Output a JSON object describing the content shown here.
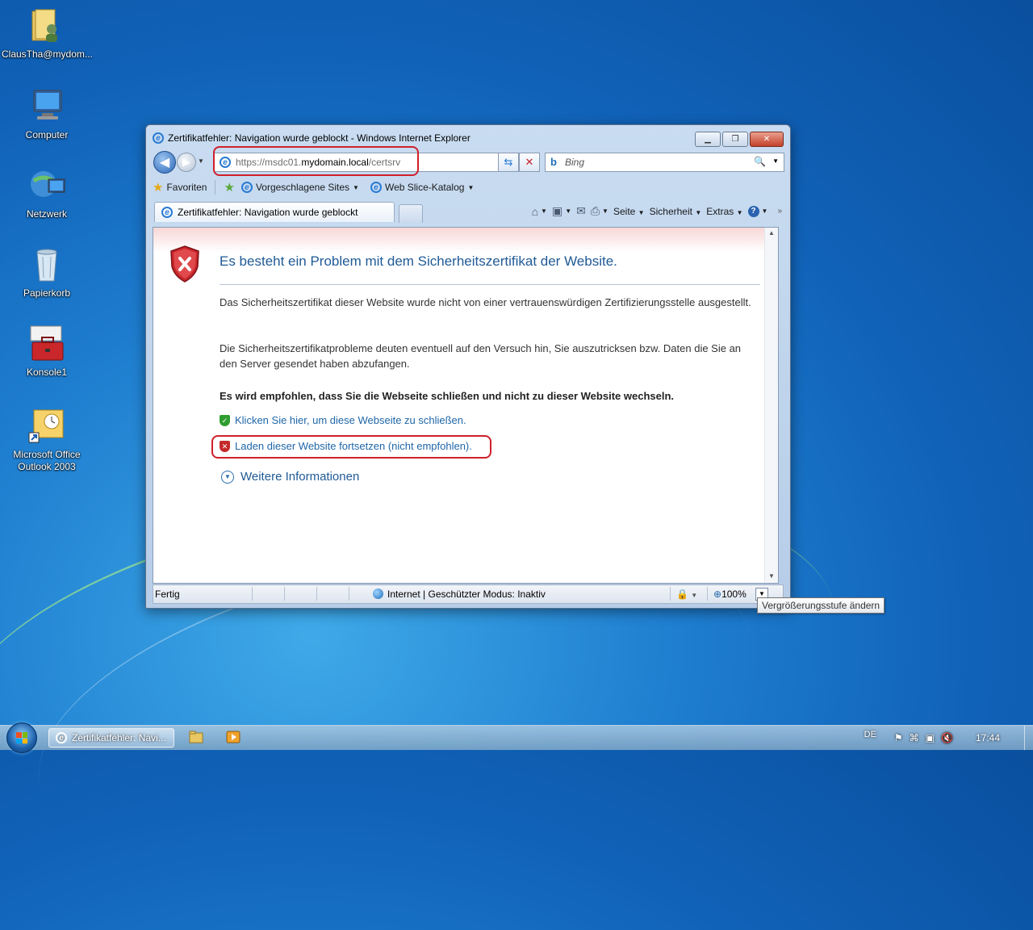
{
  "desktop": {
    "icons": [
      {
        "label": "ClausTha@mydom..."
      },
      {
        "label": "Computer"
      },
      {
        "label": "Netzwerk"
      },
      {
        "label": "Papierkorb"
      },
      {
        "label": "Konsole1"
      },
      {
        "label": "Microsoft Office Outlook 2003"
      }
    ]
  },
  "browser": {
    "title": "Zertifikatfehler: Navigation wurde geblockt - Windows Internet Explorer",
    "address": {
      "prefix": "https://msdc01.",
      "domain": "mydomain.local",
      "suffix": "/certsrv"
    },
    "search_placeholder": "Bing",
    "favorites": {
      "favorites_label": "Favoriten",
      "suggested_label": "Vorgeschlagene Sites",
      "webslice_label": "Web Slice-Katalog"
    },
    "tab_label": "Zertifikatfehler: Navigation wurde geblockt",
    "commands": {
      "page": "Seite",
      "safety": "Sicherheit",
      "tools": "Extras"
    },
    "page": {
      "heading": "Es besteht ein Problem mit dem Sicherheitszertifikat der Website.",
      "para1": "Das Sicherheitszertifikat dieser Website wurde nicht von einer vertrauenswürdigen Zertifizierungsstelle ausgestellt.",
      "para2": "Die Sicherheitszertifikatprobleme deuten eventuell auf den Versuch hin, Sie auszutricksen bzw. Daten die Sie an den Server gesendet haben abzufangen.",
      "recommendation": "Es wird empfohlen, dass Sie die Webseite schließen und nicht zu dieser Website wechseln.",
      "close_link": "Klicken Sie hier, um diese Webseite zu schließen.",
      "continue_link": "Laden dieser Website fortsetzen (nicht empfohlen).",
      "more_info": "Weitere Informationen"
    },
    "status": {
      "text": "Fertig",
      "zone": "Internet | Geschützter Modus: Inaktiv",
      "zoom": "100%"
    }
  },
  "tooltip": "Vergrößerungsstufe ändern",
  "taskbar": {
    "task_label": "Zertifikatfehler: Navi...",
    "language": "DE",
    "clock": "17:44"
  },
  "colors": {
    "annotation_ring": "#d0202a",
    "link": "#1f66a8",
    "heading": "#1f5a96"
  }
}
